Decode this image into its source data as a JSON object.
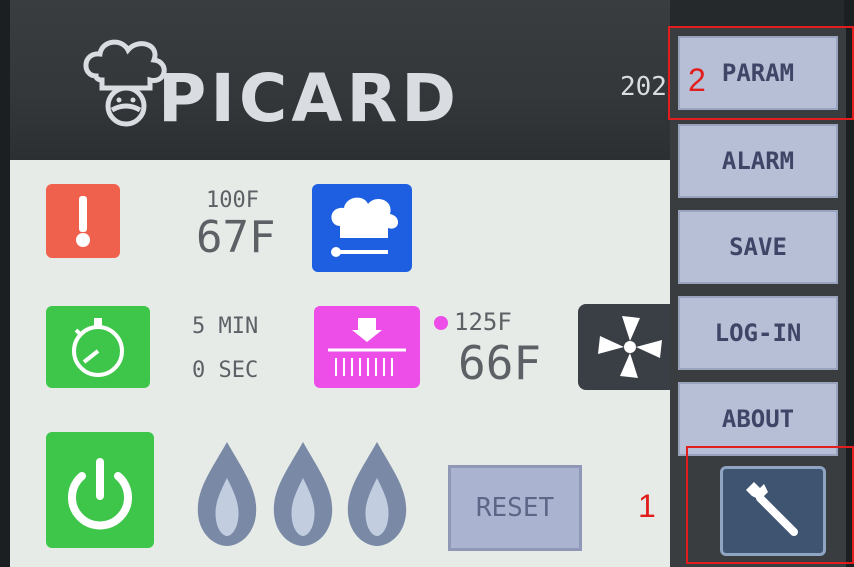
{
  "header": {
    "brand": "PICARD",
    "date_partial": "202"
  },
  "readings": {
    "temp_setpoint": "100F",
    "temp_current": "67F",
    "timer_min": "5 MIN",
    "timer_sec": "0 SEC",
    "holding_setpoint": "125F",
    "holding_current": "66F"
  },
  "buttons": {
    "reset": "RESET"
  },
  "menu": [
    {
      "label": "PARAM"
    },
    {
      "label": "ALARM"
    },
    {
      "label": "SAVE"
    },
    {
      "label": "LOG-IN"
    },
    {
      "label": "ABOUT"
    }
  ],
  "annotations": {
    "a1": "1",
    "a2": "2"
  },
  "colors": {
    "thermometer_tile": "#f0614d",
    "chef_tile": "#1d5fe0",
    "timer_tile": "#3ec64a",
    "holding_tile": "#ee4ee8",
    "fan_tile": "#3a3e45",
    "power_tile": "#3ec64a",
    "flame": "#7a8aa6",
    "highlight": "#e11d1d"
  },
  "icons": {
    "thermometer": "thermometer-icon",
    "chef_hat": "chef-hat-icon",
    "stopwatch": "stopwatch-icon",
    "holding": "holding-icon",
    "fan": "fan-icon",
    "power": "power-icon",
    "flame": "flame-icon",
    "wrench": "wrench-icon"
  }
}
